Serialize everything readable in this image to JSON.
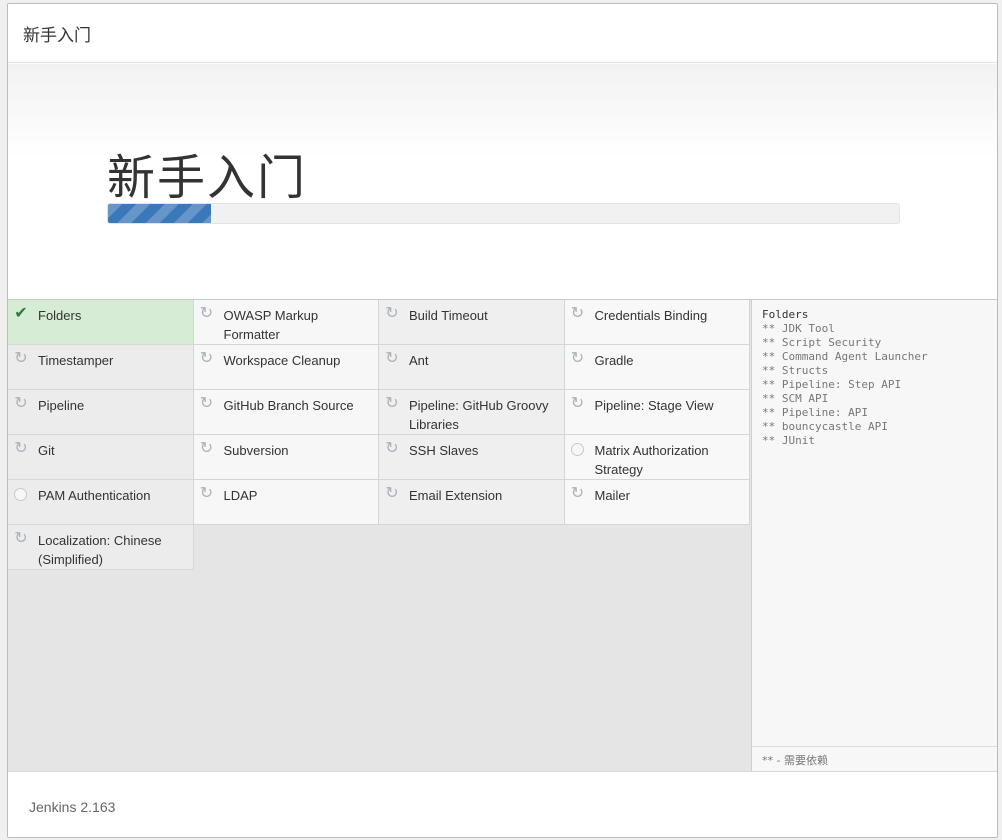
{
  "header": {
    "title": "新手入门"
  },
  "hero": {
    "title": "新手入门",
    "progress_percent": 13,
    "progress_color": "#3b78b7"
  },
  "plugins": [
    {
      "label": "Folders",
      "status": "success"
    },
    {
      "label": "OWASP Markup Formatter",
      "status": "installing"
    },
    {
      "label": "Build Timeout",
      "status": "installing"
    },
    {
      "label": "Credentials Binding",
      "status": "installing"
    },
    {
      "label": "Timestamper",
      "status": "installing"
    },
    {
      "label": "Workspace Cleanup",
      "status": "installing"
    },
    {
      "label": "Ant",
      "status": "installing"
    },
    {
      "label": "Gradle",
      "status": "installing"
    },
    {
      "label": "Pipeline",
      "status": "installing-active"
    },
    {
      "label": "GitHub Branch Source",
      "status": "installing"
    },
    {
      "label": "Pipeline: GitHub Groovy Libraries",
      "status": "installing-active"
    },
    {
      "label": "Pipeline: Stage View",
      "status": "installing"
    },
    {
      "label": "Git",
      "status": "installing"
    },
    {
      "label": "Subversion",
      "status": "installing"
    },
    {
      "label": "SSH Slaves",
      "status": "installing"
    },
    {
      "label": "Matrix Authorization Strategy",
      "status": "pending"
    },
    {
      "label": "PAM Authentication",
      "status": "pending"
    },
    {
      "label": "LDAP",
      "status": "installing"
    },
    {
      "label": "Email Extension",
      "status": "installing"
    },
    {
      "label": "Mailer",
      "status": "installing"
    },
    {
      "label": "Localization: Chinese (Simplified)",
      "status": "installing"
    }
  ],
  "log": {
    "lines": [
      "Folders",
      "** JDK Tool",
      "** Script Security",
      "** Command Agent Launcher",
      "** Structs",
      "** Pipeline: Step API",
      "** SCM API",
      "** Pipeline: API",
      "** bouncycastle API",
      "** JUnit"
    ],
    "legend": "** - 需要依赖"
  },
  "footer": {
    "version": "Jenkins 2.163"
  },
  "icons": {
    "success": "check-icon",
    "installing": "refresh-icon",
    "pending": "circle-icon"
  }
}
